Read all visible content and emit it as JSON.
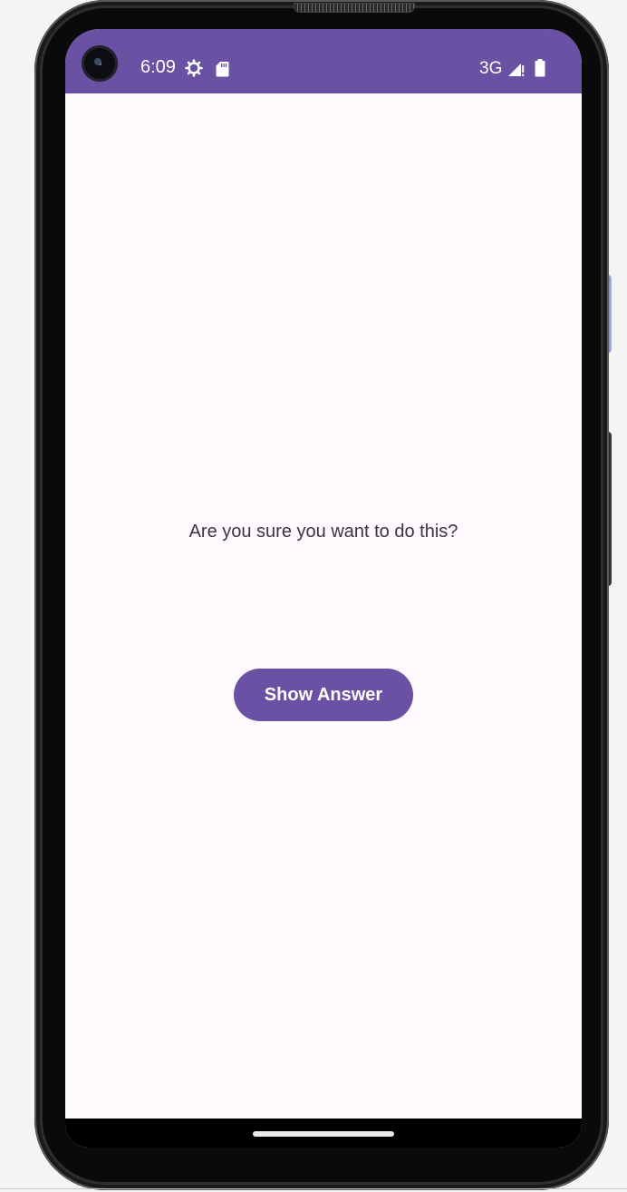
{
  "status_bar": {
    "time": "6:09",
    "network": "3G",
    "background_color": "#6a51a3",
    "icons": [
      "gear-icon",
      "sdcard-icon",
      "signal-icon",
      "battery-icon"
    ]
  },
  "main": {
    "question": "Are you sure you want to do this?",
    "show_answer_label": "Show Answer",
    "accent_color": "#6a51a3",
    "background_color": "#fdf9fc"
  }
}
